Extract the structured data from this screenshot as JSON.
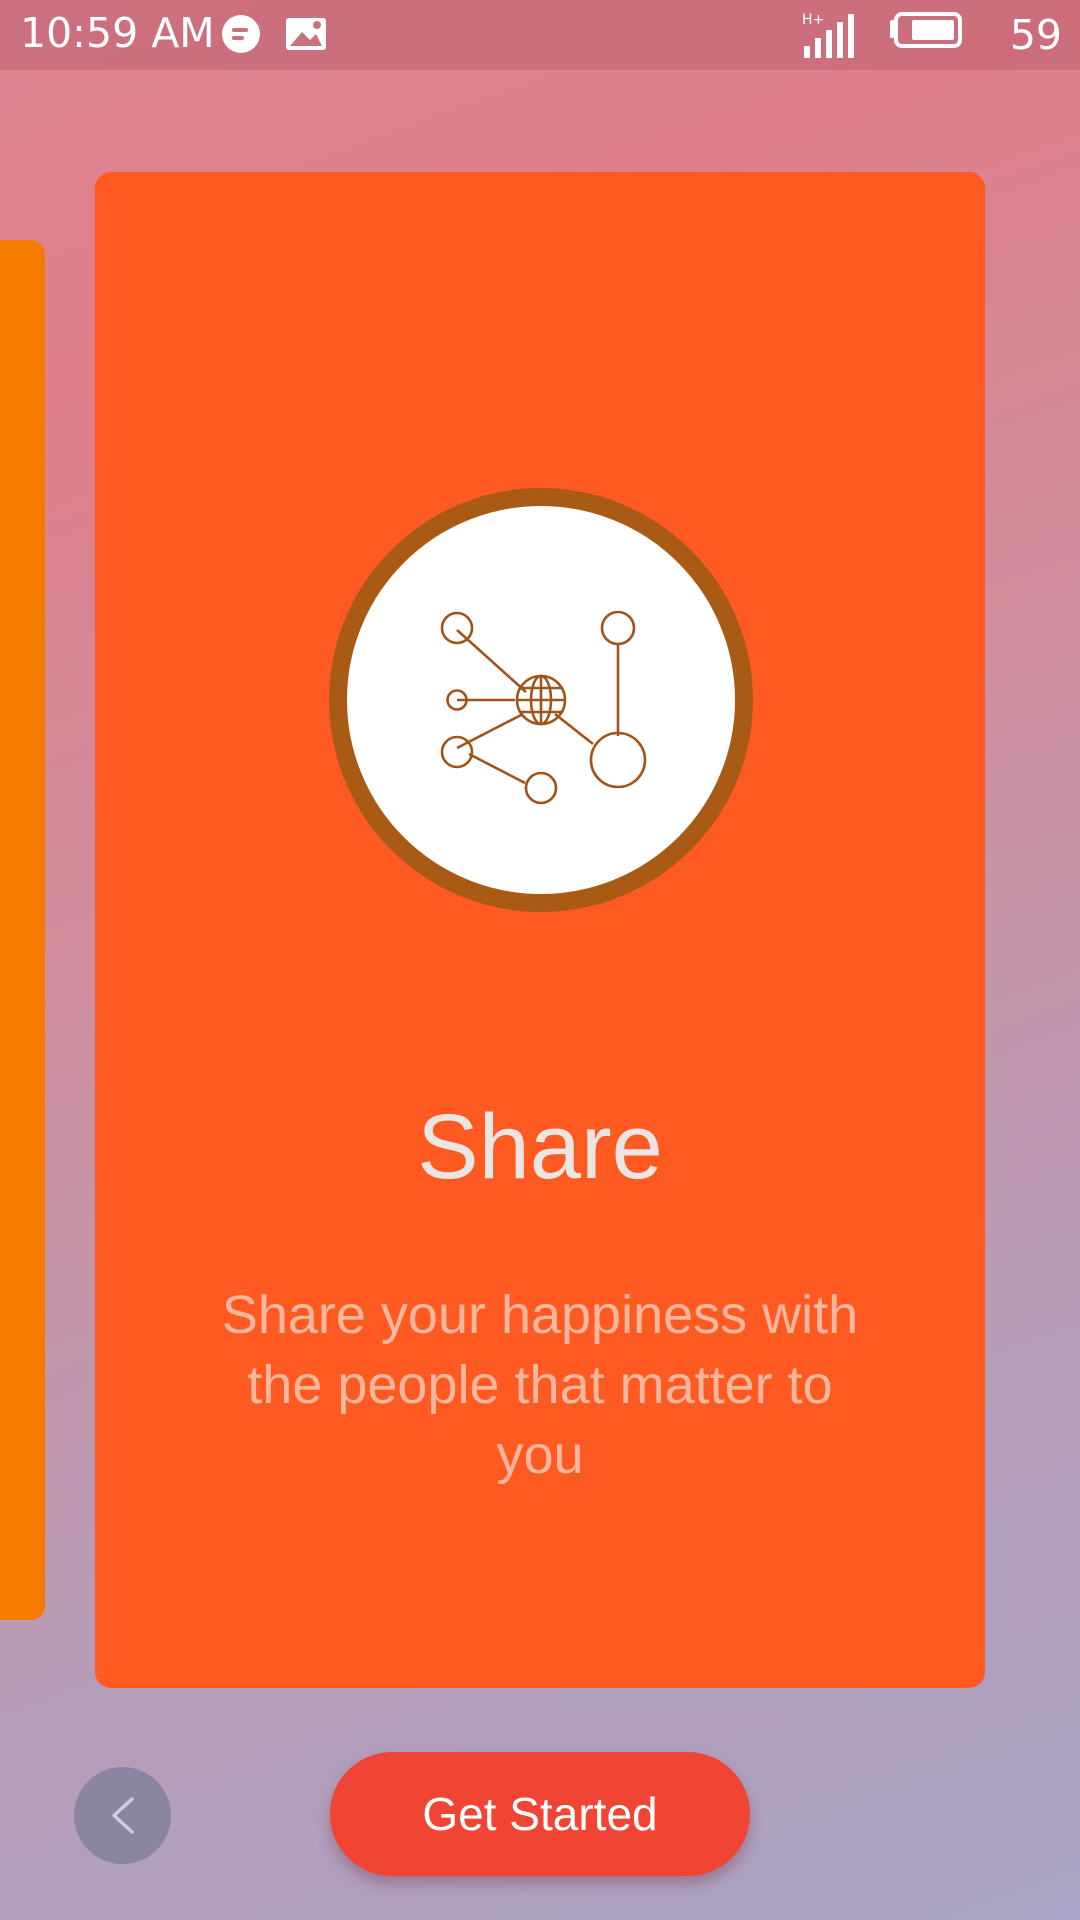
{
  "status_bar": {
    "time": "10:59 AM",
    "battery_level": "59",
    "network_type": "H+",
    "icons": [
      "chat-bubble-icon",
      "image-icon",
      "signal-icon",
      "battery-icon"
    ]
  },
  "onboarding": {
    "title": "Share",
    "description": "Share your happiness with the people that matter to you",
    "illustration_icon": "network-globe-icon",
    "colors": {
      "card": "#ff5a22",
      "side_card": "#f57a00",
      "accent_ring": "#a95b16",
      "button": "#f04435"
    }
  },
  "controls": {
    "prev_icon": "chevron-left-icon",
    "get_started_label": "Get Started"
  }
}
